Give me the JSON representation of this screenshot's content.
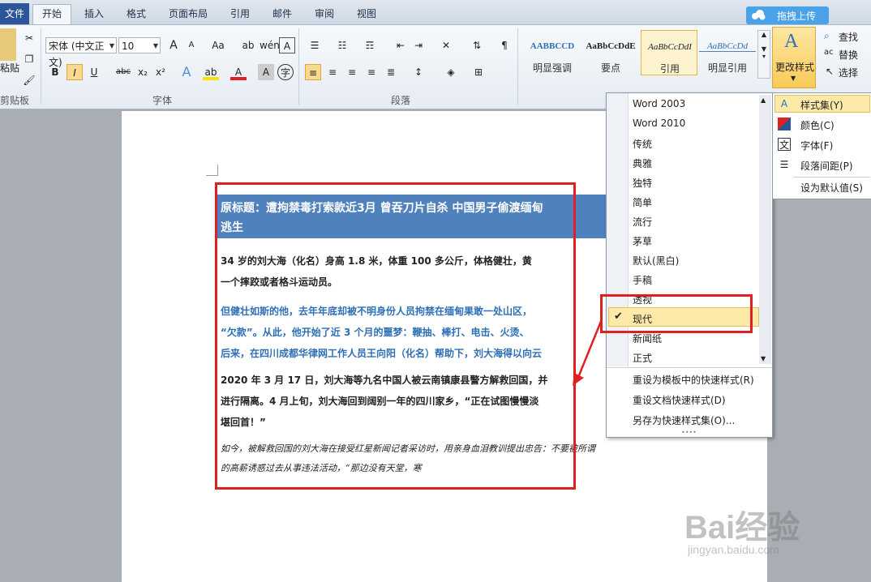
{
  "tabs": {
    "file": "文件",
    "home": "开始",
    "insert": "插入",
    "format": "格式",
    "layout": "页面布局",
    "references": "引用",
    "mailings": "邮件",
    "review": "审阅",
    "view": "视图"
  },
  "upload_label": "拖拽上传",
  "clipboard": {
    "paste": "粘贴",
    "group": "剪贴板"
  },
  "font": {
    "name": "宋体 (中文正文)",
    "size": "10",
    "group": "字体",
    "bold": "B",
    "italic": "I",
    "underline": "U",
    "strike": "abc",
    "sub": "x₂",
    "sup": "x²",
    "grow": "A",
    "shrink": "A",
    "case": "Aa"
  },
  "paragraph": {
    "group": "段落"
  },
  "styles": [
    {
      "sample": "AABBCCD",
      "name": "明显强调"
    },
    {
      "sample": "AaBbCcDdE",
      "name": "要点"
    },
    {
      "sample": "AaBbCcDdI",
      "name": "引用"
    },
    {
      "sample": "AaBbCcDd",
      "name": "明显引用"
    }
  ],
  "change_styles": "更改样式",
  "editing": {
    "find": "查找",
    "replace": "替换",
    "select": "选择"
  },
  "document": {
    "headline1": "原标题：遭拘禁毒打索款近3月 曾吞刀片自杀 中国男子偷渡缅甸",
    "headline2": "逃生",
    "p1a": "34 岁的刘大海（化名）身高 1.8 米，体重 100 多公斤，体格健壮，黄",
    "p1b": "一个摔跤或者格斗运动员。",
    "p2a": "但健壮如斯的他，去年年底却被不明身份人员拘禁在缅甸果敢一处山区，",
    "p2b": "“欠款”。从此，他开始了近 3 个月的噩梦：鞭抽、棒打、电击、火烫、",
    "p2c": "后来，在四川成都华律网工作人员王向阳（化名）帮助下，刘大海得以向云",
    "p3a": "2020 年 3 月 17 日，刘大海等九名中国人被云南镇康县警方解救回国，并",
    "p3b": "进行隔离。4 月上旬，刘大海回到阔别一年的四川家乡，“正在试图慢慢淡",
    "p3c": "堪回首！”",
    "p4a": "如今，被解救回国的刘大海在接受红星新闻记者采访时，用亲身血泪教训提出忠告：不要被所谓",
    "p4b": "的高薪诱惑过去从事违法活动，“那边没有天堂，寒"
  },
  "menu": {
    "items": [
      "Word 2003",
      "Word 2010",
      "传统",
      "典雅",
      "独特",
      "简单",
      "流行",
      "茅草",
      "默认(黑白)",
      "手稿",
      "透视",
      "现代",
      "新闻纸",
      "正式"
    ],
    "selected": "现代",
    "actions": [
      "重设为模板中的快速样式(R)",
      "重设文档快速样式(D)",
      "另存为快速样式集(O)..."
    ]
  },
  "submenu": {
    "items": [
      "样式集(Y)",
      "颜色(C)",
      "字体(F)",
      "段落间距(P)",
      "设为默认值(S)"
    ]
  },
  "watermark": {
    "brand": "Bai经验",
    "url": "jingyan.baidu.com"
  },
  "colors": {
    "accent": "#2b579a",
    "headline_bg": "#4f81bd",
    "annotation": "#e02020",
    "highlight": "#fde9a8"
  }
}
